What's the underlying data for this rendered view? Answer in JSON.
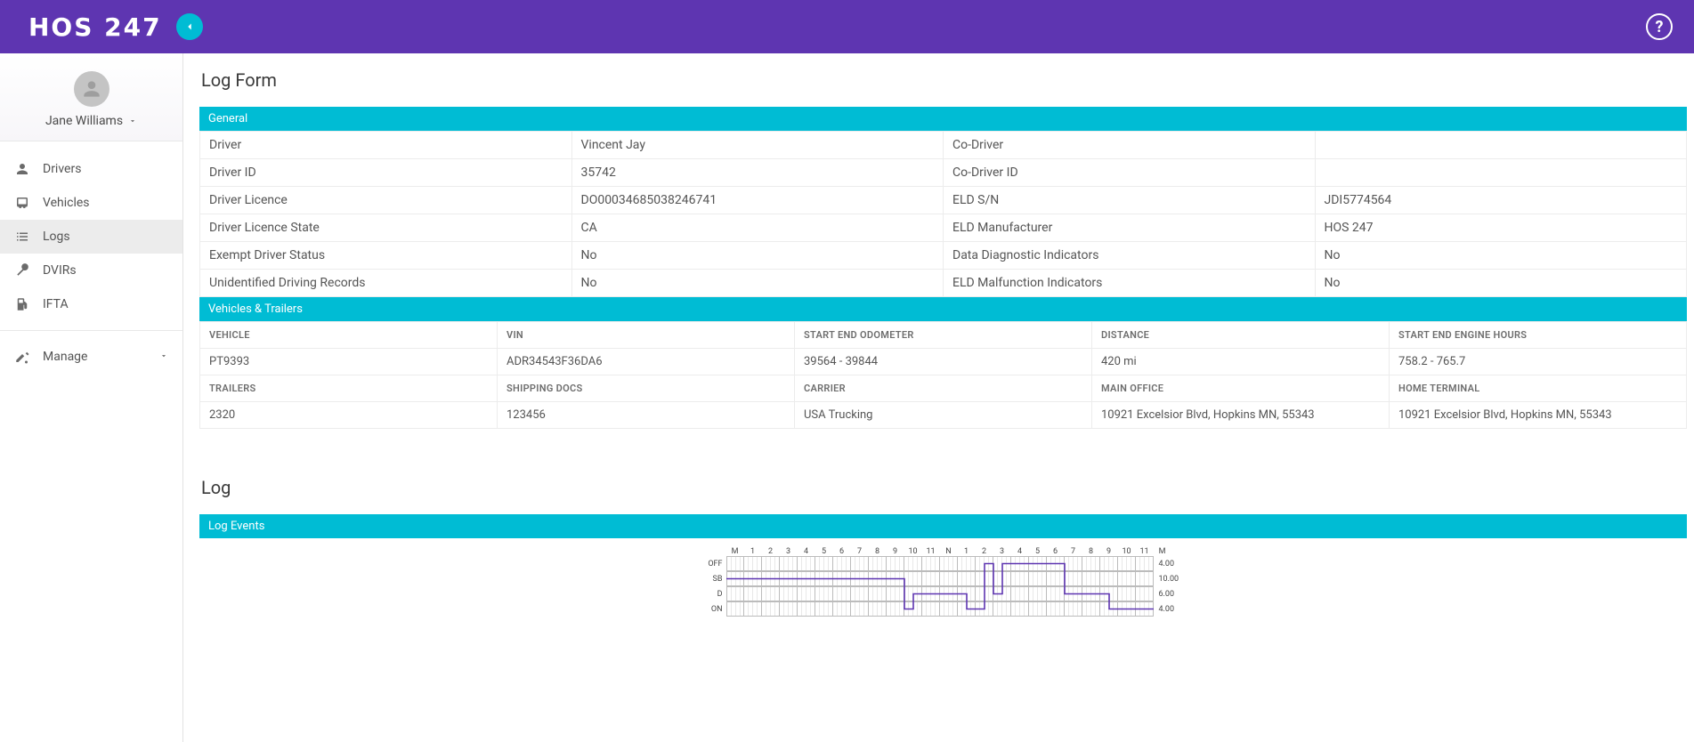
{
  "app": {
    "brand": "HOS 247"
  },
  "user": {
    "name": "Jane Williams"
  },
  "sidebar": {
    "items": [
      {
        "label": "Drivers"
      },
      {
        "label": "Vehicles"
      },
      {
        "label": "Logs"
      },
      {
        "label": "DVIRs"
      },
      {
        "label": "IFTA"
      }
    ],
    "manage": "Manage"
  },
  "page": {
    "title_form": "Log Form",
    "title_log": "Log",
    "section_general": "General",
    "section_vehicles": "Vehicles & Trailers",
    "section_events": "Log Events"
  },
  "general": {
    "rows": [
      {
        "l1": "Driver",
        "v1": "Vincent Jay",
        "l2": "Co-Driver",
        "v2": ""
      },
      {
        "l1": "Driver ID",
        "v1": "35742",
        "l2": "Co-Driver ID",
        "v2": ""
      },
      {
        "l1": "Driver Licence",
        "v1": "DO00034685038246741",
        "l2": "ELD S/N",
        "v2": "JDI5774564"
      },
      {
        "l1": "Driver Licence State",
        "v1": "CA",
        "l2": "ELD Manufacturer",
        "v2": "HOS 247"
      },
      {
        "l1": "Exempt Driver Status",
        "v1": "No",
        "l2": "Data Diagnostic Indicators",
        "v2": "No"
      },
      {
        "l1": "Unidentified Driving Records",
        "v1": "No",
        "l2": "ELD Malfunction Indicators",
        "v2": "No"
      }
    ]
  },
  "vehicles": {
    "headers_a": [
      "VEHICLE",
      "VIN",
      "START END ODOMETER",
      "DISTANCE",
      "START END ENGINE HOURS"
    ],
    "row_a": [
      "PT9393",
      "ADR34543F36DA6",
      "39564 - 39844",
      "420 mi",
      "758.2 - 765.7"
    ],
    "headers_b": [
      "TRAILERS",
      "SHIPPING DOCS",
      "CARRIER",
      "MAIN OFFICE",
      "HOME TERMINAL"
    ],
    "row_b": [
      "2320",
      "123456",
      "USA Trucking",
      "10921 Excelsior Blvd, Hopkins MN, 55343",
      "10921 Excelsior Blvd, Hopkins MN, 55343"
    ]
  },
  "chart_data": {
    "type": "hos-grid",
    "hours": [
      "M",
      "1",
      "2",
      "3",
      "4",
      "5",
      "6",
      "7",
      "8",
      "9",
      "10",
      "11",
      "N",
      "1",
      "2",
      "3",
      "4",
      "5",
      "6",
      "7",
      "8",
      "9",
      "10",
      "11",
      "M"
    ],
    "statuses": [
      "OFF",
      "SB",
      "D",
      "ON"
    ],
    "totals": {
      "OFF": "4.00",
      "SB": "10.00",
      "D": "6.00",
      "ON": "4.00"
    },
    "segments": [
      {
        "status": "SB",
        "start": 0.0,
        "end": 10.0
      },
      {
        "status": "ON",
        "start": 10.0,
        "end": 10.5
      },
      {
        "status": "D",
        "start": 10.5,
        "end": 13.5
      },
      {
        "status": "ON",
        "start": 13.5,
        "end": 14.5
      },
      {
        "status": "OFF",
        "start": 14.5,
        "end": 15.0
      },
      {
        "status": "D",
        "start": 15.0,
        "end": 15.5
      },
      {
        "status": "OFF",
        "start": 15.5,
        "end": 19.0
      },
      {
        "status": "D",
        "start": 19.0,
        "end": 21.5
      },
      {
        "status": "ON",
        "start": 21.5,
        "end": 24.0
      }
    ]
  }
}
